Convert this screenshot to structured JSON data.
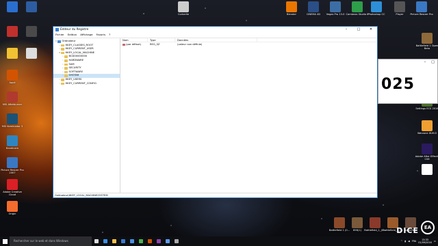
{
  "desktop": {
    "left_icons": [
      {
        "label": "",
        "color": "#2a6fd0"
      },
      {
        "label": "",
        "color": "#2d5da0"
      },
      {
        "label": "",
        "color": "#c0302c"
      },
      {
        "label": "",
        "color": "#4a4a4a"
      },
      {
        "label": "",
        "color": "#f1c232"
      },
      {
        "label": "",
        "color": "#dddddd"
      },
      {
        "label": "Appli",
        "color": "#d35400"
      },
      {
        "label": "MSI Afterburner",
        "color": "#b03a2e"
      },
      {
        "label": "MSI Kombustor 3",
        "color": "#1a5276"
      },
      {
        "label": "Bandicam",
        "color": "#2e86c1"
      },
      {
        "label": "Picture Resizer Pro 2007",
        "color": "#3a78c3"
      },
      {
        "label": "Adobe Creative Cloud",
        "color": "#da1f26"
      },
      {
        "label": "Origin",
        "color": "#f56c2d"
      }
    ],
    "top_icons": [
      {
        "label": "Corbeille",
        "color": "#cccccc"
      },
      {
        "label": "Blender",
        "color": "#ea7600"
      },
      {
        "label": "CINEMA 4D",
        "color": "#2b4e86"
      },
      {
        "label": "Vegas Pro 13.0",
        "color": "#3c6ea5"
      },
      {
        "label": "Camtasia Studio 8",
        "color": "#2e9e4a"
      },
      {
        "label": "Photoshop CC",
        "color": "#2d8fd8"
      },
      {
        "label": "Player",
        "color": "#555555"
      },
      {
        "label": "Picture Resizer Pro",
        "color": "#3a78c3"
      }
    ],
    "right_icons": [
      {
        "label": "Battlefield 1 Open Beta",
        "color": "#8e6a3a"
      },
      {
        "label": "",
        "color": "#7b3f2b"
      },
      {
        "label": "Settings ECS 2016",
        "color": "#4a6f2a"
      },
      {
        "label": "Warzone W.M.D",
        "color": "#f0a030"
      },
      {
        "label": "Adobe After Effects CS6",
        "color": "#2a1a5e"
      },
      {
        "label": "",
        "color": "#ffffff"
      }
    ],
    "bottom_thumbs": [
      {
        "label": "Battlefield 1 (0...",
        "color": "#8a4a2a"
      },
      {
        "label": "698(1)",
        "color": "#7a5a3a"
      },
      {
        "label": "Battlefield_1_(0...",
        "color": "#8a3a2a"
      },
      {
        "label": "Battlefield_1_(...",
        "color": "#9a5a2a"
      },
      {
        "label": "Battlefield",
        "color": "#6a4a3a"
      }
    ],
    "dice_logo": "DICE",
    "ea_logo": "EA"
  },
  "regedit": {
    "title": "Éditeur du Registre",
    "menu": [
      "Fichier",
      "Edition",
      "Affichage",
      "Favoris",
      "?"
    ],
    "tree": [
      {
        "label": "Ordinateur",
        "level": 0,
        "expanded": true,
        "type": "pc"
      },
      {
        "label": "HKEY_CLASSES_ROOT",
        "level": 1,
        "expanded": false
      },
      {
        "label": "HKEY_CURRENT_USER",
        "level": 1,
        "expanded": false
      },
      {
        "label": "HKEY_LOCAL_MACHINE",
        "level": 1,
        "expanded": true
      },
      {
        "label": "BCD00000000",
        "level": 2,
        "expanded": false
      },
      {
        "label": "HARDWARE",
        "level": 2,
        "expanded": false
      },
      {
        "label": "SAM",
        "level": 2,
        "expanded": false
      },
      {
        "label": "SECURITY",
        "level": 2,
        "expanded": false
      },
      {
        "label": "SOFTWARE",
        "level": 2,
        "expanded": false
      },
      {
        "label": "SYSTEM",
        "level": 2,
        "expanded": false,
        "selected": true
      },
      {
        "label": "HKEY_USERS",
        "level": 1,
        "expanded": false
      },
      {
        "label": "HKEY_CURRENT_CONFIG",
        "level": 1,
        "expanded": false
      }
    ],
    "columns": [
      "Nom",
      "Type",
      "Données"
    ],
    "rows": [
      {
        "name": "(par défaut)",
        "type": "REG_SZ",
        "data": "(valeur non définie)"
      }
    ],
    "status": "Ordinateur\\HKEY_LOCAL_MACHINE\\SYSTEM"
  },
  "second_window": {
    "text": "025"
  },
  "taskbar": {
    "search_placeholder": "Rechercher sur le web et dans Windows",
    "apps": [
      {
        "icon": "task-view-icon",
        "color": "#dddddd"
      },
      {
        "icon": "edge-icon",
        "color": "#3a8ee6"
      },
      {
        "icon": "explorer-icon",
        "color": "#f3c04a"
      },
      {
        "icon": "store-icon",
        "color": "#3a7ad0"
      },
      {
        "icon": "mail-icon",
        "color": "#4a90e2"
      },
      {
        "icon": "chrome-icon",
        "color": "#4caf50"
      },
      {
        "icon": "media-icon",
        "color": "#d35400"
      },
      {
        "icon": "app-icon",
        "color": "#8e44ad"
      },
      {
        "icon": "regedit-icon",
        "color": "#5d9cec"
      },
      {
        "icon": "app2-icon",
        "color": "#aaaaaa"
      }
    ],
    "lang": "FRA",
    "time": "13:33",
    "date": "01/09/2016"
  }
}
